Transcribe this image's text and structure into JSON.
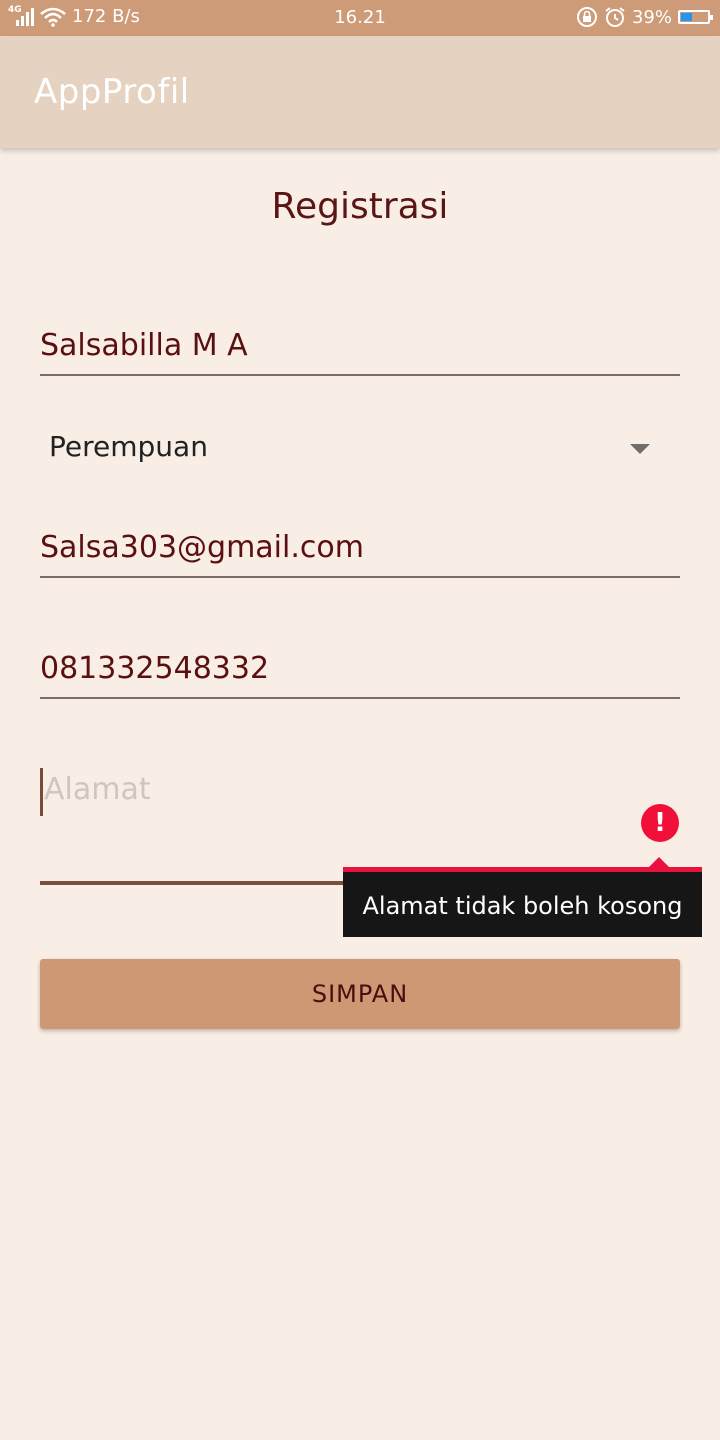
{
  "status_bar": {
    "network_type": "4G",
    "speed": "172 B/s",
    "time": "16.21",
    "battery_percent": "39%",
    "battery_level": 0.39,
    "icons": [
      "signal-icon",
      "wifi-icon",
      "rotation-lock-icon",
      "alarm-icon",
      "battery-icon"
    ]
  },
  "app_bar": {
    "title": "AppProfil"
  },
  "form": {
    "heading": "Registrasi",
    "name_value": "Salsabilla M A",
    "gender_value": "Perempuan",
    "email_value": "Salsa303@gmail.com",
    "phone_value": "081332548332",
    "address_placeholder": "Alamat",
    "address_error": "Alamat tidak boleh kosong",
    "submit_label": "SIMPAN"
  },
  "colors": {
    "status_bar": "#cd9b77",
    "app_bar": "#e5d2c0",
    "background": "#f8eee5",
    "accent_text": "#5a1515",
    "button": "#cd9873",
    "error": "#f0103a"
  }
}
